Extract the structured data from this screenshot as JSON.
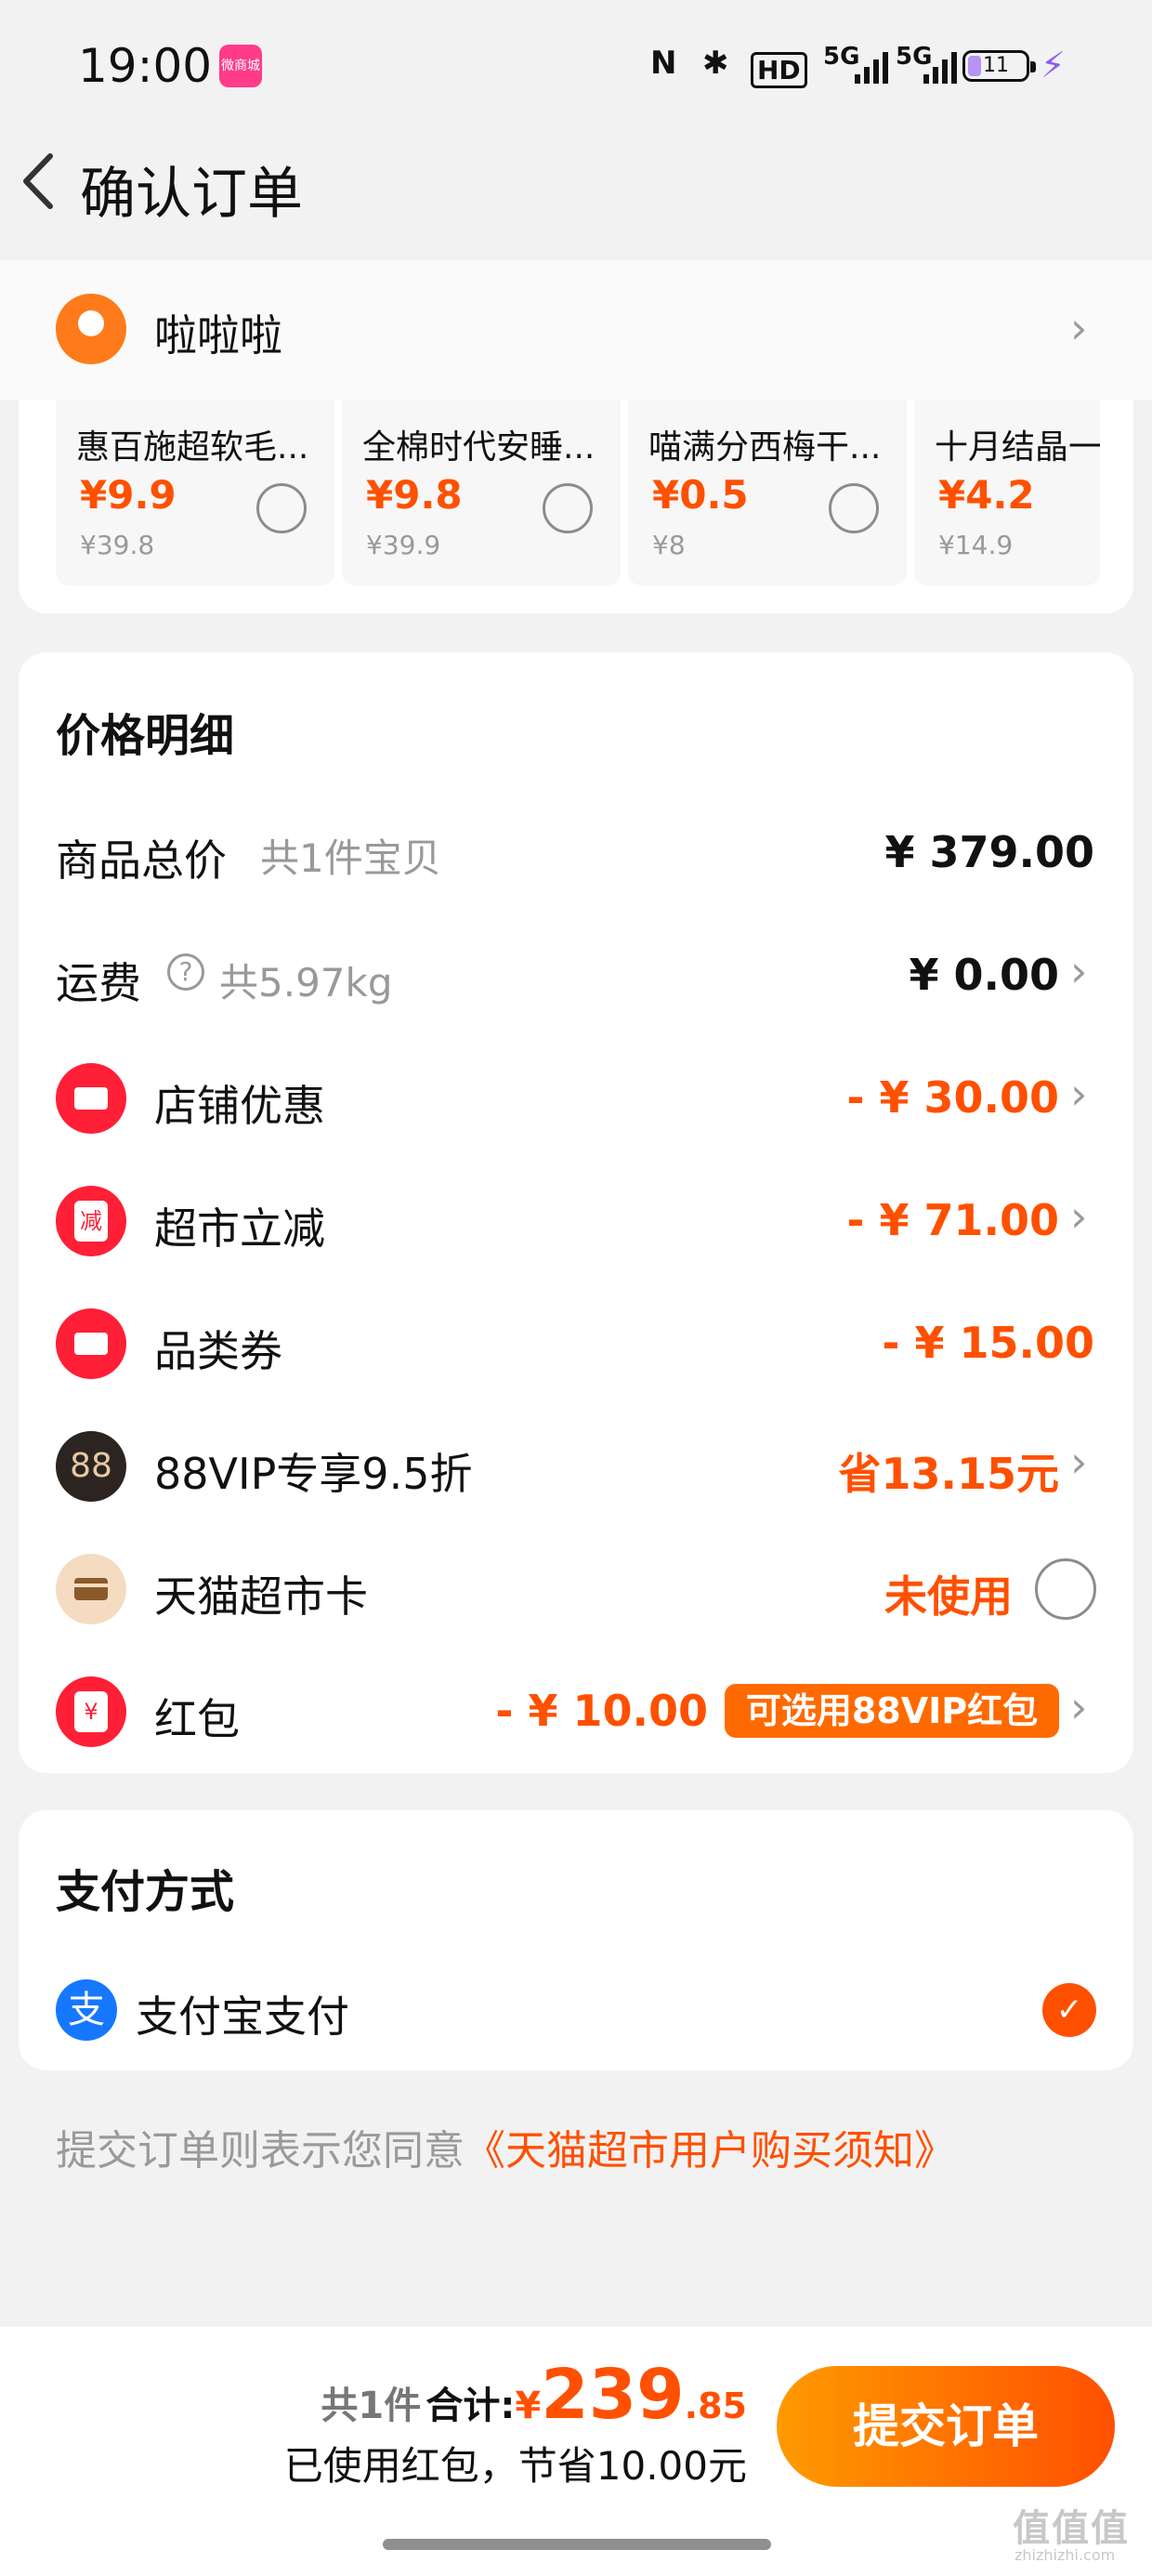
{
  "status_bar": {
    "time": "19:00",
    "app_badge": "微商城",
    "nfc": "N",
    "bluetooth": "✱",
    "hd": "HD",
    "signal1": "5G",
    "signal2": "5G",
    "battery": "11"
  },
  "header": {
    "title": "确认订单"
  },
  "address": {
    "text": "啦啦啦"
  },
  "products": [
    {
      "name": "惠百施超软毛...",
      "price": "¥9.9",
      "original": "¥39.8"
    },
    {
      "name": "全棉时代安睡...",
      "price": "¥9.8",
      "original": "¥39.9"
    },
    {
      "name": "喵满分西梅干...",
      "price": "¥0.5",
      "original": "¥8"
    },
    {
      "name": "十月结晶一",
      "price": "¥4.2",
      "original": "¥14.9"
    }
  ],
  "price_detail": {
    "title": "价格明细",
    "total": {
      "label": "商品总价",
      "note": "共1件宝贝",
      "amount": "¥ 379.00"
    },
    "shipping": {
      "label": "运费",
      "note": "共5.97kg",
      "amount": "¥ 0.00"
    },
    "store_discount": {
      "label": "店铺优惠",
      "amount": "- ¥ 30.00"
    },
    "supermarket_cut": {
      "label": "超市立减",
      "amount": "- ¥ 71.00",
      "icon_text": "减"
    },
    "category_coupon": {
      "label": "品类券",
      "amount": "- ¥ 15.00"
    },
    "vip": {
      "label": "88VIP专享9.5折",
      "amount": "省13.15元",
      "icon_text": "88"
    },
    "tmall_card": {
      "label": "天猫超市卡",
      "amount": "未使用"
    },
    "red_packet": {
      "label": "红包",
      "amount": "- ¥ 10.00",
      "badge": "可选用88VIP红包",
      "icon_text": "¥"
    }
  },
  "payment": {
    "title": "支付方式",
    "method": "支付宝支付",
    "icon_text": "支"
  },
  "terms": {
    "prefix": "提交订单则表示您同意",
    "link": "《天猫超市用户购买须知》"
  },
  "bottom": {
    "count": "共1件",
    "total_label": "合计:",
    "currency": "¥",
    "total_int": "239",
    "total_dec": ".85",
    "saving": "已使用红包，节省10.00元",
    "submit": "提交订单"
  },
  "watermark": {
    "main": "值值值",
    "sub": "zhizhizhi.com"
  },
  "colors": {
    "accent": "#ff5000",
    "red": "#ff1f36",
    "alipay": "#1677ff"
  }
}
